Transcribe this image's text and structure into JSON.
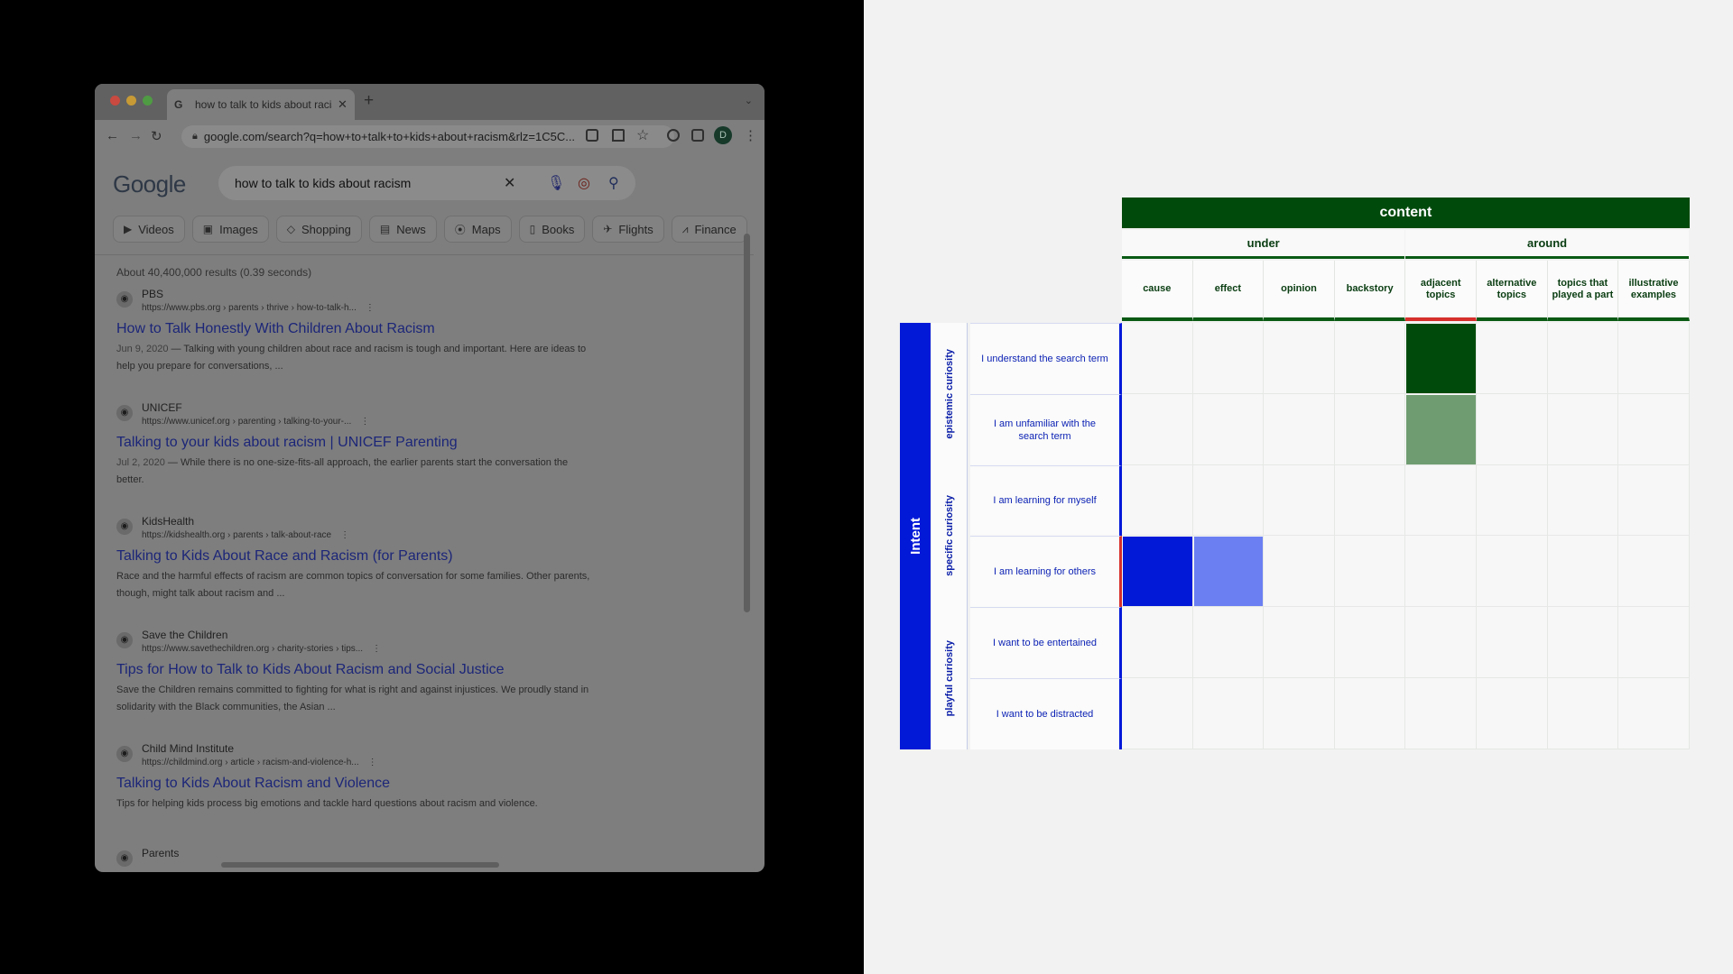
{
  "browser": {
    "tab_title": "how to talk to kids about racism",
    "tab_favicon": "G",
    "address_url": "google.com/search?q=how+to+talk+to+kids+about+racism&rlz=1C5C...",
    "profile_initial": "D"
  },
  "google": {
    "logo": "Google",
    "query": "how to talk to kids about racism",
    "filters": [
      {
        "label": "Videos",
        "icon": "▶"
      },
      {
        "label": "Images",
        "icon": "▣"
      },
      {
        "label": "Shopping",
        "icon": "◇"
      },
      {
        "label": "News",
        "icon": "▤"
      },
      {
        "label": "Maps",
        "icon": "⦿"
      },
      {
        "label": "Books",
        "icon": "▯"
      },
      {
        "label": "Flights",
        "icon": "✈"
      },
      {
        "label": "Finance",
        "icon": "⩘"
      }
    ],
    "result_stats": "About 40,400,000 results (0.39 seconds)",
    "results": [
      {
        "site": "PBS",
        "url": "https://www.pbs.org › parents › thrive › how-to-talk-h...",
        "title": "How to Talk Honestly With Children About Racism",
        "date": "Jun 9, 2020",
        "snippet": "Talking with young children about race and racism is tough and important. Here are ideas to help you prepare for conversations, ..."
      },
      {
        "site": "UNICEF",
        "url": "https://www.unicef.org › parenting › talking-to-your-...",
        "title": "Talking to your kids about racism | UNICEF Parenting",
        "date": "Jul 2, 2020",
        "snippet": "While there is no one-size-fits-all approach, the earlier parents start the conversation the better."
      },
      {
        "site": "KidsHealth",
        "url": "https://kidshealth.org › parents › talk-about-race",
        "title": "Talking to Kids About Race and Racism (for Parents)",
        "date": "",
        "snippet": "Race and the harmful effects of racism are common topics of conversation for some families. Other parents, though, might talk about racism and ..."
      },
      {
        "site": "Save the Children",
        "url": "https://www.savethechildren.org › charity-stories › tips...",
        "title": "Tips for How to Talk to Kids About Racism and Social Justice",
        "date": "",
        "snippet": "Save the Children remains committed to fighting for what is right and against injustices. We proudly stand in solidarity with the Black communities, the Asian ..."
      },
      {
        "site": "Child Mind Institute",
        "url": "https://childmind.org › article › racism-and-violence-h...",
        "title": "Talking to Kids About Racism and Violence",
        "date": "",
        "snippet": "Tips for helping kids process big emotions and tackle hard questions about racism and violence."
      },
      {
        "site": "Parents",
        "url": "",
        "title": "",
        "date": "",
        "snippet": ""
      }
    ]
  },
  "matrix": {
    "content_header": "content",
    "groups": [
      "under",
      "around"
    ],
    "columns": [
      "cause",
      "effect",
      "opinion",
      "backstory",
      "adjacent topics",
      "alternative topics",
      "topics that played a part",
      "illustrative examples"
    ],
    "intent_label": "Intent",
    "intent_groups": [
      "epistemic curiosity",
      "specific curiosity",
      "playful curiosity"
    ],
    "rows": [
      "I understand the search term",
      "I am unfamiliar with the search term",
      "I am learning for myself",
      "I am learning for others",
      "I want to be entertained",
      "I want to be distracted"
    ],
    "highlighted_column": "adjacent topics",
    "highlighted_row": "I am learning for others",
    "colors": {
      "content_header": "#004a0c",
      "intent_bar": "#0219d8",
      "flag": "#d7302d",
      "dark_green": "#004b0c",
      "light_green": "#6f9d71",
      "dark_blue": "#0219d8",
      "light_blue": "#6b7ff2"
    },
    "filled_cells": [
      {
        "row": 0,
        "col": 4,
        "color": "#004b0c"
      },
      {
        "row": 1,
        "col": 4,
        "color": "#6f9d71"
      },
      {
        "row": 3,
        "col": 0,
        "color": "#0219d8"
      },
      {
        "row": 3,
        "col": 1,
        "color": "#6b7ff2"
      }
    ]
  }
}
